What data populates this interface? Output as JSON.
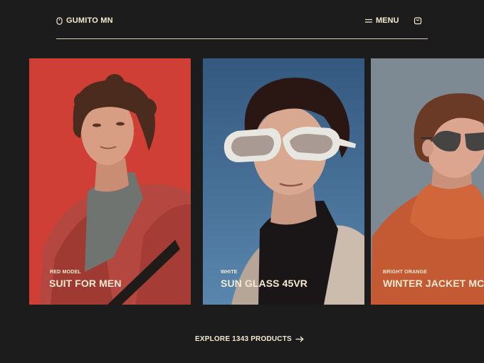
{
  "header": {
    "brand": "GUMITO MN",
    "menu_label": "MENU"
  },
  "products": [
    {
      "tag": "RED MODEL",
      "title": "SUIT FOR MEN",
      "bg_color": "#cf3f35"
    },
    {
      "tag": "WHITE",
      "title": "SUN GLASS 45VR",
      "bg_color": "#3f6c9a"
    },
    {
      "tag": "BRIGHT ORANGE",
      "title": "WINTER JACKET MC",
      "bg_color": "#7d8a93"
    }
  ],
  "explore_label": "EXPLORE 1343 PRODUCTS",
  "colors": {
    "background": "#1c1c1c",
    "text": "#f4ead2",
    "rule": "#d8cfb8"
  },
  "icons": {
    "brand": "mouse-icon",
    "menu": "menu-lines-icon",
    "cart": "bag-icon",
    "explore": "arrow-right-icon"
  }
}
